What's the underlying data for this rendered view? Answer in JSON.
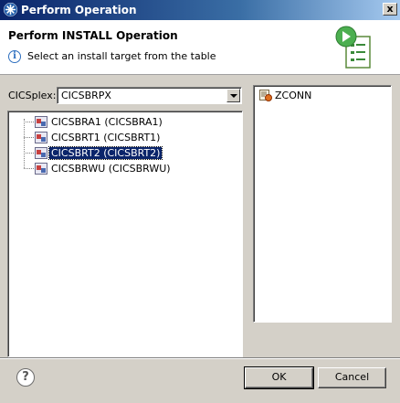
{
  "window": {
    "title": "Perform Operation",
    "close_label": "x"
  },
  "header": {
    "title": "Perform INSTALL Operation",
    "message": "Select an install target from the table",
    "info_icon": "info-icon"
  },
  "cicsplex": {
    "label": "CICSplex:",
    "selected": "CICSBRPX"
  },
  "tree": {
    "items": [
      {
        "label": "CICSBRA1 (CICSBRA1)",
        "selected": false
      },
      {
        "label": "CICSBRT1 (CICSBRT1)",
        "selected": false
      },
      {
        "label": "CICSBRT2 (CICSBRT2)",
        "selected": true
      },
      {
        "label": "CICSBRWU (CICSBRWU)",
        "selected": false
      }
    ]
  },
  "resources": {
    "items": [
      {
        "label": "ZCONN"
      }
    ]
  },
  "footer": {
    "help_label": "?",
    "ok_label": "OK",
    "cancel_label": "Cancel"
  },
  "colors": {
    "title_bar": "#0a246a",
    "selection": "#0a246a",
    "dialog_bg": "#d4d0c8"
  }
}
